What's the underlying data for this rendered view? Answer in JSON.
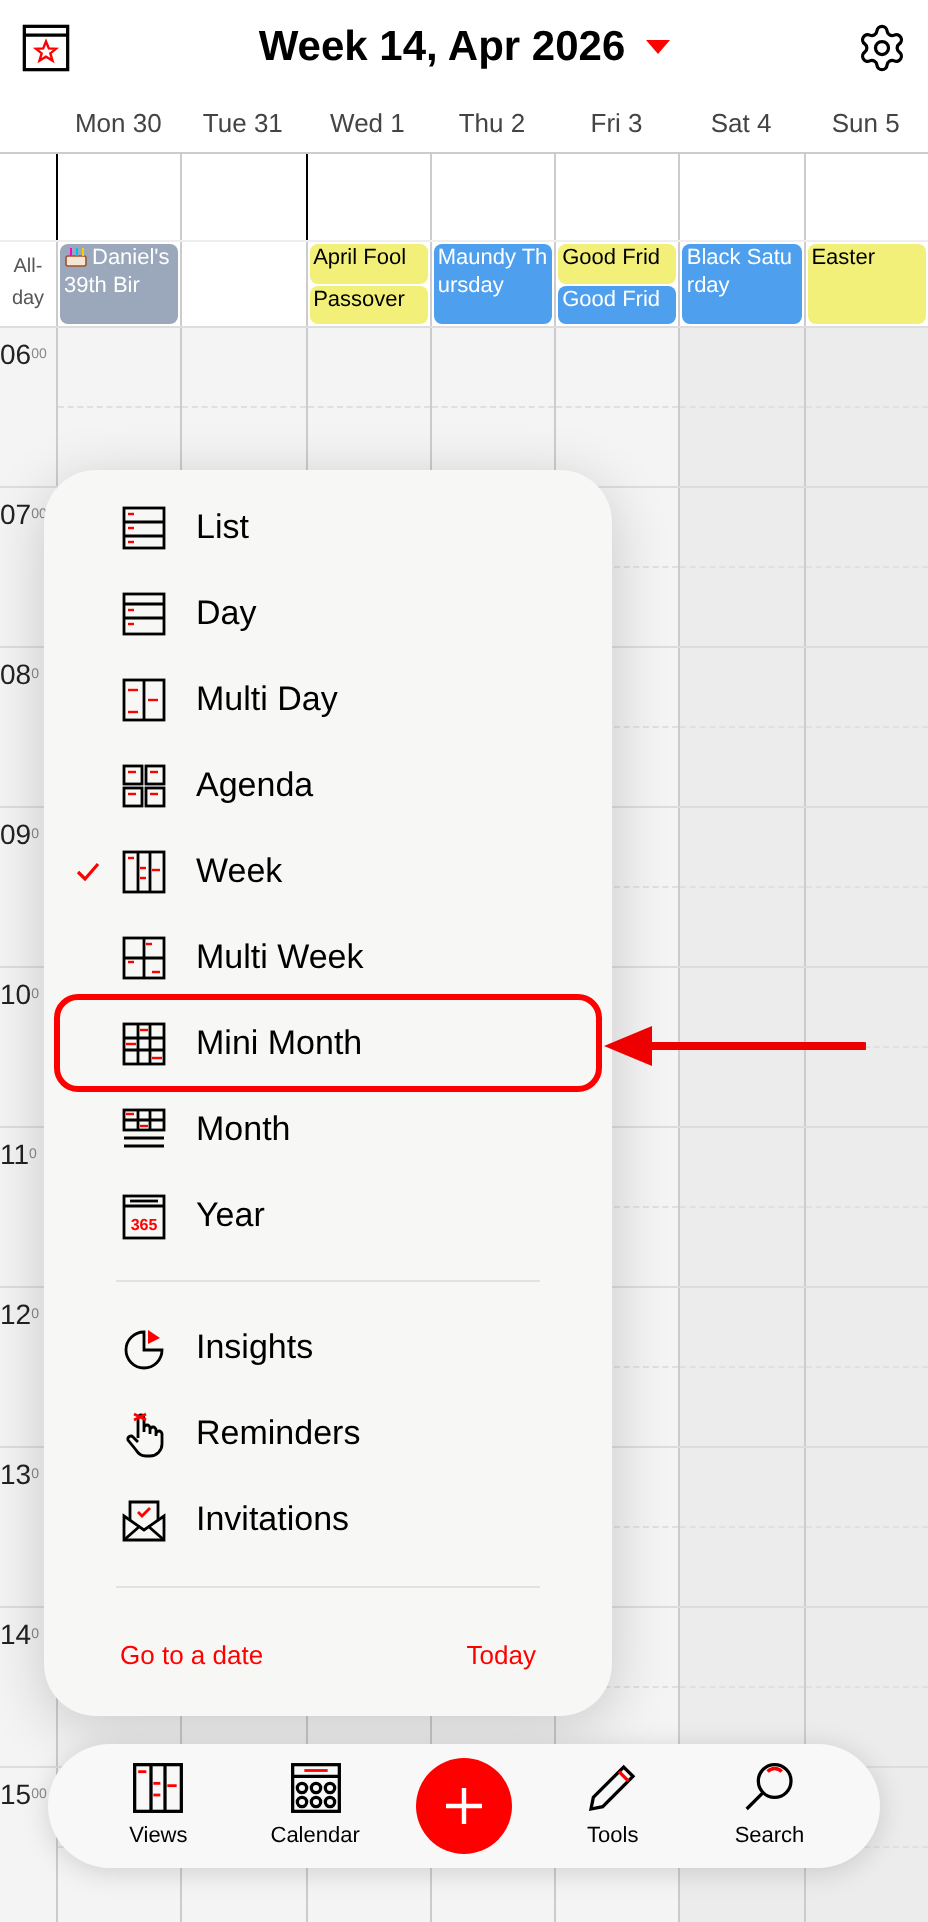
{
  "header": {
    "title": "Week 14, Apr 2026"
  },
  "days": [
    {
      "label": "Mon 30",
      "events": [
        {
          "title": "Daniel's 39th Bir",
          "color": "#9ba8bb",
          "birthday": true
        }
      ]
    },
    {
      "label": "Tue 31"
    },
    {
      "label": "Wed 1",
      "events": [
        {
          "title": "April Fool",
          "color": "#f3f07a",
          "birthday": false
        },
        {
          "title": "Passover",
          "color": "#f3f07a",
          "birthday": false
        }
      ]
    },
    {
      "label": "Thu 2",
      "events": [
        {
          "title": "Maundy Thursday",
          "color": "#4ea0ef",
          "birthday": false
        }
      ]
    },
    {
      "label": "Fri 3",
      "events": [
        {
          "title": "Good Frid",
          "color": "#f3f07a",
          "birthday": false
        },
        {
          "title": "Good Frid",
          "color": "#4ea0ef",
          "birthday": false
        }
      ]
    },
    {
      "label": "Sat 4",
      "events": [
        {
          "title": "Black Saturday",
          "color": "#4ea0ef",
          "birthday": false
        }
      ]
    },
    {
      "label": "Sun 5",
      "events": [
        {
          "title": "Easter",
          "color": "#f3f07a",
          "birthday": false
        }
      ]
    }
  ],
  "all_day_label": "All-day",
  "hours": [
    {
      "hour": "06",
      "minutes": "00"
    },
    {
      "hour": "07",
      "minutes": "00"
    },
    {
      "hour": "08",
      "minutes": "0"
    },
    {
      "hour": "09",
      "minutes": "0"
    },
    {
      "hour": "10",
      "minutes": "0"
    },
    {
      "hour": "11",
      "minutes": "0"
    },
    {
      "hour": "12",
      "minutes": "0"
    },
    {
      "hour": "13",
      "minutes": "0"
    },
    {
      "hour": "14",
      "minutes": "0"
    },
    {
      "hour": "15",
      "minutes": "00"
    }
  ],
  "menu": {
    "views": [
      {
        "label": "List",
        "selected": false,
        "highlighted": false
      },
      {
        "label": "Day",
        "selected": false,
        "highlighted": false
      },
      {
        "label": "Multi Day",
        "selected": false,
        "highlighted": false
      },
      {
        "label": "Agenda",
        "selected": false,
        "highlighted": false
      },
      {
        "label": "Week",
        "selected": true,
        "highlighted": false
      },
      {
        "label": "Multi Week",
        "selected": false,
        "highlighted": false
      },
      {
        "label": "Mini Month",
        "selected": false,
        "highlighted": true
      },
      {
        "label": "Month",
        "selected": false,
        "highlighted": false
      },
      {
        "label": "Year",
        "selected": false,
        "highlighted": false,
        "icon_text": "365"
      }
    ],
    "tools": [
      {
        "label": "Insights"
      },
      {
        "label": "Reminders"
      },
      {
        "label": "Invitations"
      }
    ],
    "go_to_date": "Go to a date",
    "today": "Today"
  },
  "tab_bar": [
    {
      "kind": "tab",
      "label": "Views"
    },
    {
      "kind": "tab",
      "label": "Calendar"
    },
    {
      "kind": "add"
    },
    {
      "kind": "tab",
      "label": "Tools"
    },
    {
      "kind": "tab",
      "label": "Search"
    }
  ]
}
